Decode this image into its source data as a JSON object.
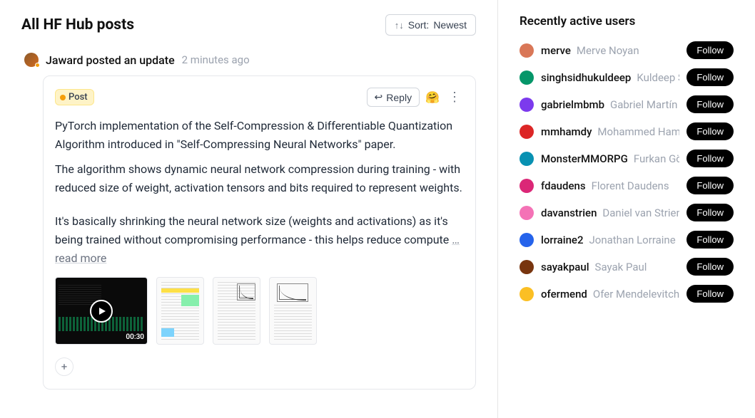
{
  "page_title": "All HF Hub posts",
  "sort": {
    "label_prefix": "Sort:",
    "value": "Newest"
  },
  "post": {
    "author": "Jaward",
    "action_text": "Jaward posted an update",
    "timestamp": "2 minutes ago",
    "badge_label": "Post",
    "reply_label": "Reply",
    "reaction_emoji": "🤗",
    "body_p1": "PyTorch implementation of the Self-Compression & Differentiable Quantization Algorithm introduced in \"Self-Compressing Neural Networks\" paper.",
    "body_p2": "The algorithm shows dynamic neural network compression during training - with reduced size of weight, activation tensors and bits required to represent weights.",
    "body_p3_truncated": "It's basically shrinking the neural network size (weights and activations) as it's being trained without compromising performance - this helps reduce compute",
    "read_more": "…read more",
    "video_duration": "00:30",
    "add_label": "+"
  },
  "sidebar": {
    "title": "Recently active users",
    "follow_label": "Follow",
    "users": [
      {
        "username": "merve",
        "fullname": "Merve Noyan",
        "color": "#d97757"
      },
      {
        "username": "singhsidhukuldeep",
        "fullname": "Kuldeep S",
        "color": "#059669"
      },
      {
        "username": "gabrielmbmb",
        "fullname": "Gabriel Martín B",
        "color": "#7c3aed"
      },
      {
        "username": "mmhamdy",
        "fullname": "Mohammed Hamd",
        "color": "#dc2626"
      },
      {
        "username": "MonsterMMORPG",
        "fullname": "Furkan Gözü",
        "color": "#0891b2"
      },
      {
        "username": "fdaudens",
        "fullname": "Florent Daudens",
        "color": "#db2777"
      },
      {
        "username": "davanstrien",
        "fullname": "Daniel van Strien",
        "color": "#f472b6"
      },
      {
        "username": "lorraine2",
        "fullname": "Jonathan Lorraine",
        "color": "#2563eb"
      },
      {
        "username": "sayakpaul",
        "fullname": "Sayak Paul",
        "color": "#78350f"
      },
      {
        "username": "ofermend",
        "fullname": "Ofer Mendelevitch",
        "color": "#fbbf24"
      }
    ]
  }
}
